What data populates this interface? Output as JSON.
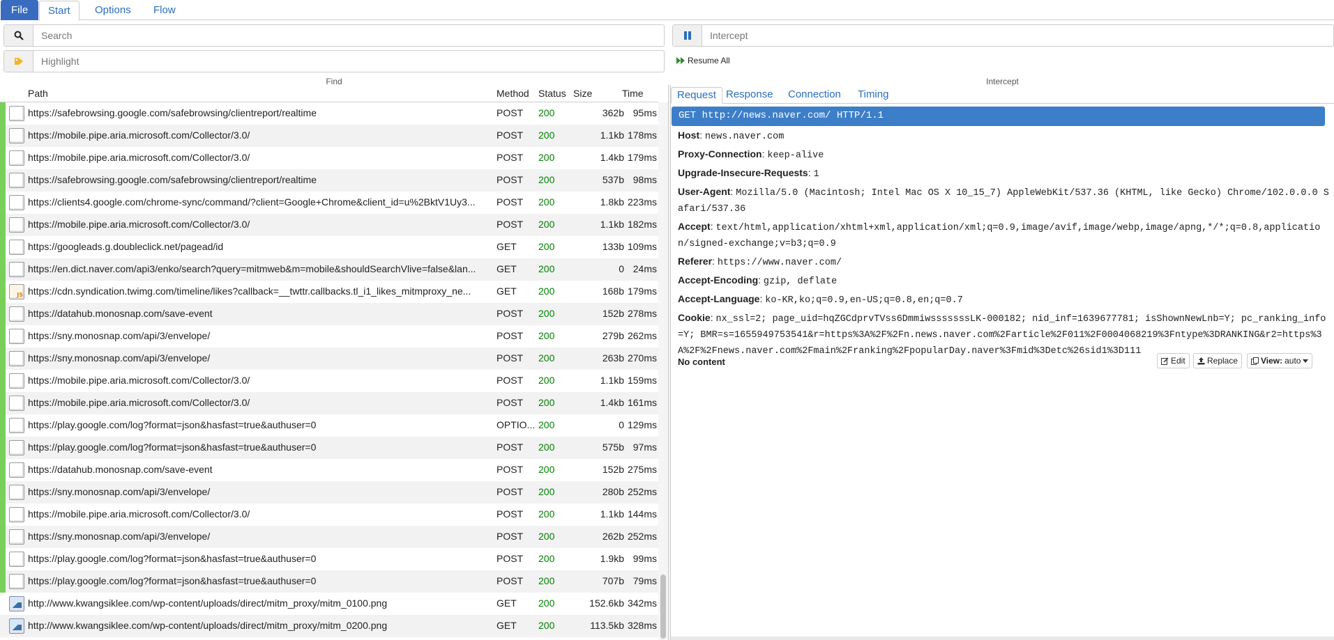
{
  "topbar": {
    "file": "File",
    "tabs": [
      "Start",
      "Options",
      "Flow"
    ]
  },
  "find": {
    "search_placeholder": "Search",
    "highlight_placeholder": "Highlight",
    "label": "Find"
  },
  "intercept": {
    "placeholder": "Intercept",
    "resume_all": "Resume All",
    "label": "Intercept"
  },
  "flows": {
    "columns": {
      "path": "Path",
      "method": "Method",
      "status": "Status",
      "size": "Size",
      "time": "Time"
    },
    "rows": [
      {
        "path": "https://safebrowsing.google.com/safebrowsing/clientreport/realtime",
        "method": "POST",
        "status": "200",
        "size": "362b",
        "time": "95ms",
        "icon": "document-icon"
      },
      {
        "path": "https://mobile.pipe.aria.microsoft.com/Collector/3.0/",
        "method": "POST",
        "status": "200",
        "size": "1.1kb",
        "time": "178ms",
        "icon": "document-icon"
      },
      {
        "path": "https://mobile.pipe.aria.microsoft.com/Collector/3.0/",
        "method": "POST",
        "status": "200",
        "size": "1.4kb",
        "time": "179ms",
        "icon": "document-icon"
      },
      {
        "path": "https://safebrowsing.google.com/safebrowsing/clientreport/realtime",
        "method": "POST",
        "status": "200",
        "size": "537b",
        "time": "98ms",
        "icon": "document-icon"
      },
      {
        "path": "https://clients4.google.com/chrome-sync/command/?client=Google+Chrome&client_id=u%2BktV1Uy3...",
        "method": "POST",
        "status": "200",
        "size": "1.8kb",
        "time": "223ms",
        "icon": "document-icon"
      },
      {
        "path": "https://mobile.pipe.aria.microsoft.com/Collector/3.0/",
        "method": "POST",
        "status": "200",
        "size": "1.1kb",
        "time": "182ms",
        "icon": "document-icon"
      },
      {
        "path": "https://googleads.g.doubleclick.net/pagead/id",
        "method": "GET",
        "status": "200",
        "size": "133b",
        "time": "109ms",
        "icon": "document-icon"
      },
      {
        "path": "https://en.dict.naver.com/api3/enko/search?query=mitmweb&m=mobile&shouldSearchVlive=false&lan...",
        "method": "GET",
        "status": "200",
        "size": "0",
        "time": "24ms",
        "icon": "document-icon"
      },
      {
        "path": "https://cdn.syndication.twimg.com/timeline/likes?callback=__twttr.callbacks.tl_i1_likes_mitmproxy_ne...",
        "method": "GET",
        "status": "200",
        "size": "168b",
        "time": "179ms",
        "icon": "js-file-icon"
      },
      {
        "path": "https://datahub.monosnap.com/save-event",
        "method": "POST",
        "status": "200",
        "size": "152b",
        "time": "278ms",
        "icon": "document-icon"
      },
      {
        "path": "https://sny.monosnap.com/api/3/envelope/",
        "method": "POST",
        "status": "200",
        "size": "279b",
        "time": "262ms",
        "icon": "document-icon"
      },
      {
        "path": "https://sny.monosnap.com/api/3/envelope/",
        "method": "POST",
        "status": "200",
        "size": "263b",
        "time": "270ms",
        "icon": "document-icon"
      },
      {
        "path": "https://mobile.pipe.aria.microsoft.com/Collector/3.0/",
        "method": "POST",
        "status": "200",
        "size": "1.1kb",
        "time": "159ms",
        "icon": "document-icon"
      },
      {
        "path": "https://mobile.pipe.aria.microsoft.com/Collector/3.0/",
        "method": "POST",
        "status": "200",
        "size": "1.4kb",
        "time": "161ms",
        "icon": "document-icon"
      },
      {
        "path": "https://play.google.com/log?format=json&hasfast=true&authuser=0",
        "method": "OPTIO...",
        "status": "200",
        "size": "0",
        "time": "129ms",
        "icon": "document-icon"
      },
      {
        "path": "https://play.google.com/log?format=json&hasfast=true&authuser=0",
        "method": "POST",
        "status": "200",
        "size": "575b",
        "time": "97ms",
        "icon": "document-icon"
      },
      {
        "path": "https://datahub.monosnap.com/save-event",
        "method": "POST",
        "status": "200",
        "size": "152b",
        "time": "275ms",
        "icon": "document-icon"
      },
      {
        "path": "https://sny.monosnap.com/api/3/envelope/",
        "method": "POST",
        "status": "200",
        "size": "280b",
        "time": "252ms",
        "icon": "document-icon"
      },
      {
        "path": "https://mobile.pipe.aria.microsoft.com/Collector/3.0/",
        "method": "POST",
        "status": "200",
        "size": "1.1kb",
        "time": "144ms",
        "icon": "document-icon"
      },
      {
        "path": "https://sny.monosnap.com/api/3/envelope/",
        "method": "POST",
        "status": "200",
        "size": "262b",
        "time": "252ms",
        "icon": "document-icon"
      },
      {
        "path": "https://play.google.com/log?format=json&hasfast=true&authuser=0",
        "method": "POST",
        "status": "200",
        "size": "1.9kb",
        "time": "99ms",
        "icon": "document-icon"
      },
      {
        "path": "https://play.google.com/log?format=json&hasfast=true&authuser=0",
        "method": "POST",
        "status": "200",
        "size": "707b",
        "time": "79ms",
        "icon": "document-icon"
      },
      {
        "path": "http://www.kwangsiklee.com/wp-content/uploads/direct/mitm_proxy/mitm_0100.png",
        "method": "GET",
        "status": "200",
        "size": "152.6kb",
        "time": "342ms",
        "icon": "image-file-icon"
      },
      {
        "path": "http://www.kwangsiklee.com/wp-content/uploads/direct/mitm_proxy/mitm_0200.png",
        "method": "GET",
        "status": "200",
        "size": "113.5kb",
        "time": "328ms",
        "icon": "image-file-icon"
      }
    ]
  },
  "detail": {
    "tabs": [
      "Request",
      "Response",
      "Connection",
      "Timing"
    ],
    "request_line": "GET http://news.naver.com/ HTTP/1.1",
    "headers": [
      {
        "name": "Host",
        "value": "news.naver.com"
      },
      {
        "name": "Proxy-Connection",
        "value": "keep-alive"
      },
      {
        "name": "Upgrade-Insecure-Requests",
        "value": "1"
      },
      {
        "name": "User-Agent",
        "value": "Mozilla/5.0 (Macintosh; Intel Mac OS X 10_15_7) AppleWebKit/537.36 (KHTML, like Gecko) Chrome/102.0.0.0 Safari/537.36"
      },
      {
        "name": "Accept",
        "value": "text/html,application/xhtml+xml,application/xml;q=0.9,image/avif,image/webp,image/apng,*/*;q=0.8,application/signed-exchange;v=b3;q=0.9"
      },
      {
        "name": "Referer",
        "value": "https://www.naver.com/"
      },
      {
        "name": "Accept-Encoding",
        "value": "gzip, deflate"
      },
      {
        "name": "Accept-Language",
        "value": "ko-KR,ko;q=0.9,en-US;q=0.8,en;q=0.7"
      },
      {
        "name": "Cookie",
        "value": "nx_ssl=2; page_uid=hqZGCdprvTVss6DmmiwsssssssLK-000182; nid_inf=1639677781; isShownNewLnb=Y; pc_ranking_info=Y; BMR=s=1655949753541&r=https%3A%2F%2Fn.news.naver.com%2Farticle%2F011%2F0004068219%3Fntype%3DRANKING&r2=https%3A%2F%2Fnews.naver.com%2Fmain%2Franking%2FpopularDay.naver%3Fmid%3Detc%26sid1%3D111"
      }
    ],
    "no_content": "No content",
    "buttons": {
      "edit": "Edit",
      "replace": "Replace",
      "view_label": "View:",
      "view_value": "auto"
    }
  },
  "colors": {
    "accent": "#396cbf",
    "status_ok": "#008000",
    "flow_bar": "#78d05b",
    "request_line_bg": "#3d7ec8"
  }
}
